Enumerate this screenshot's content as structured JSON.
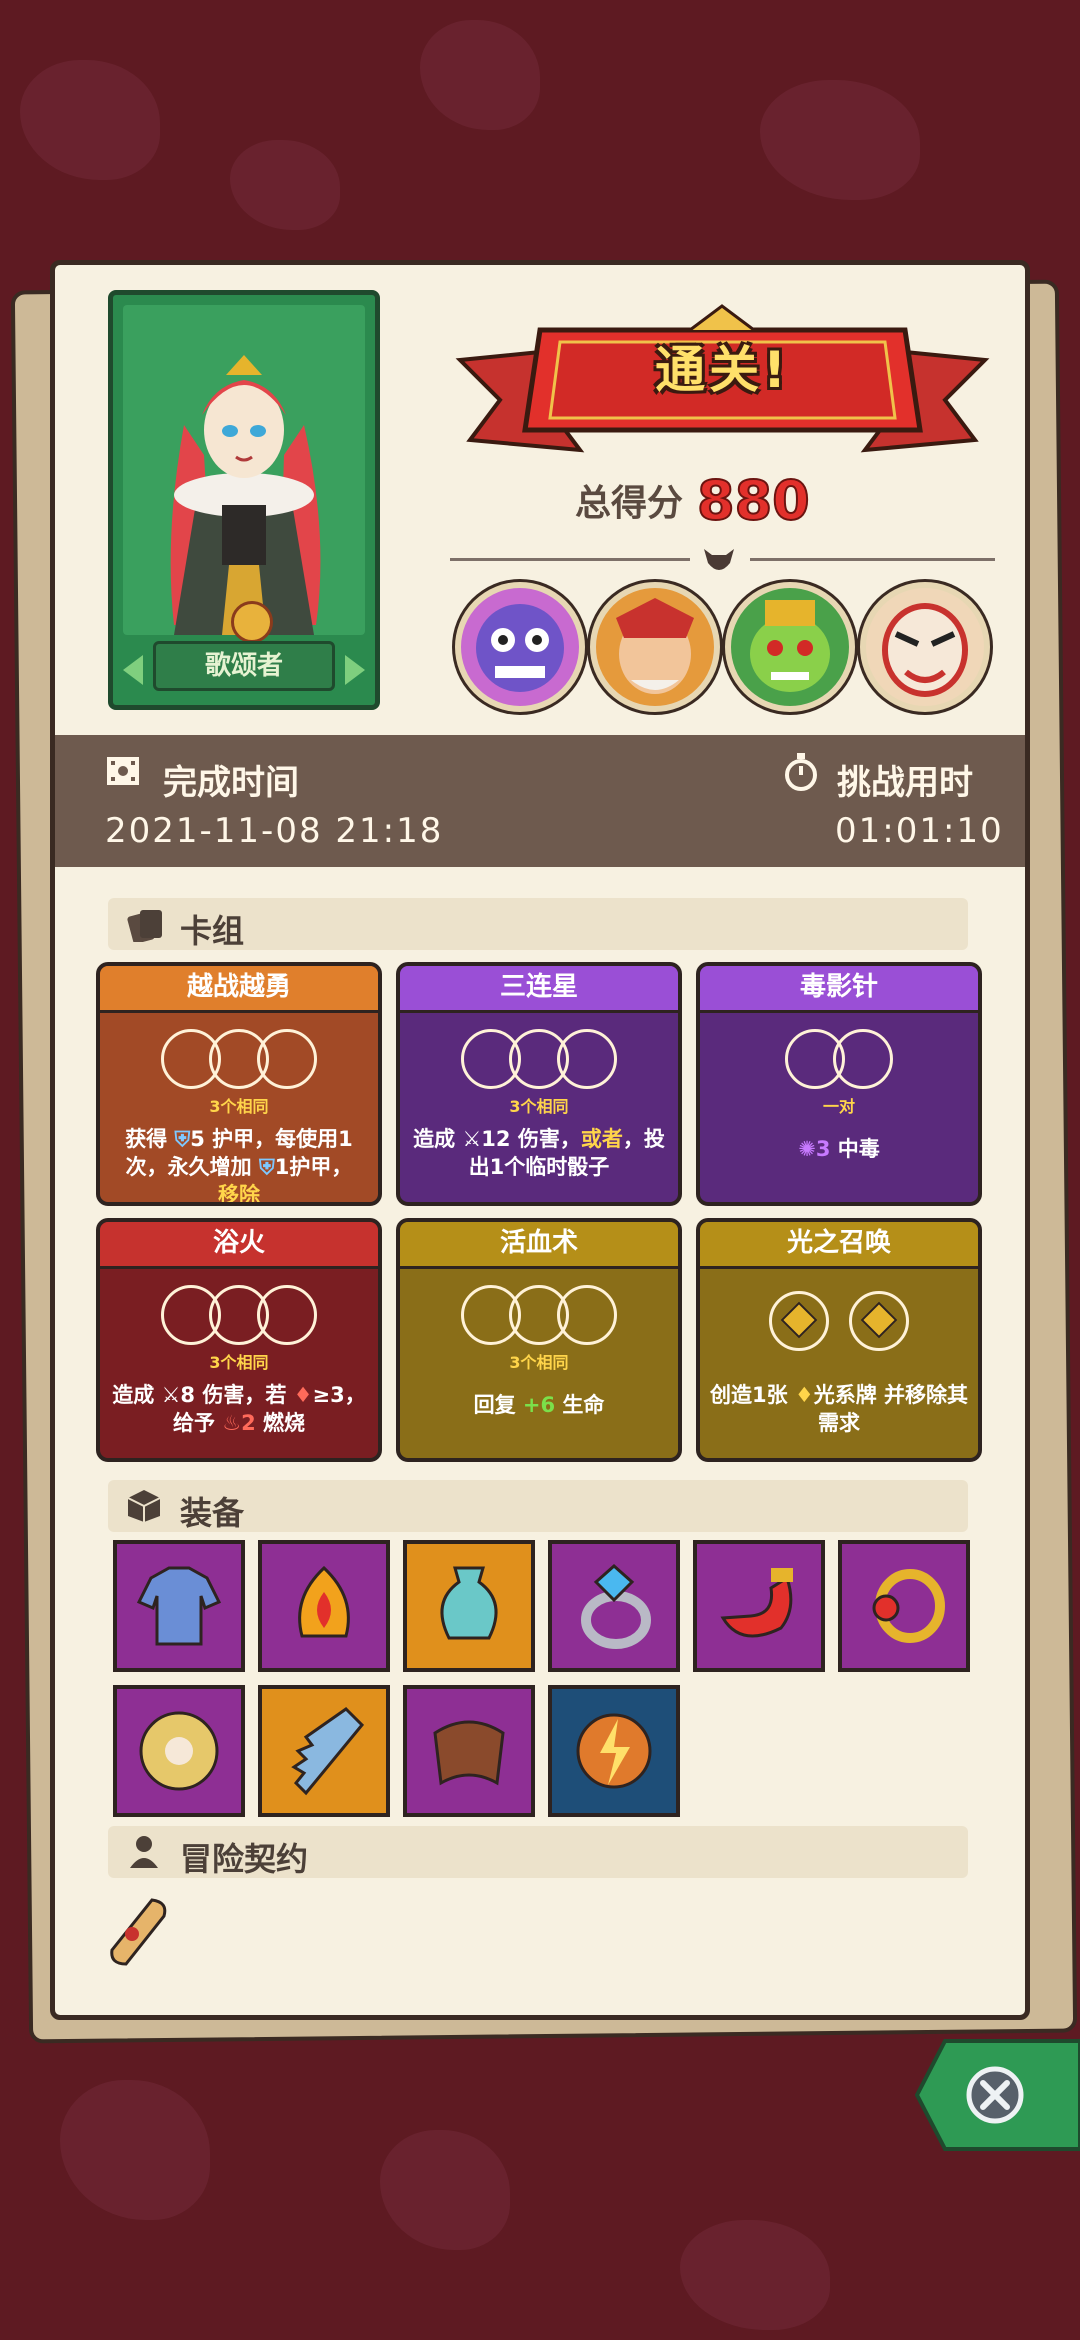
{
  "hero": {
    "name": "歌颂者"
  },
  "result": {
    "banner": "通关!",
    "score_label": "总得分",
    "score_value": "880"
  },
  "time": {
    "finish_label": "完成时间",
    "finish_value": "2021-11-08 21:18",
    "duration_label": "挑战用时",
    "duration_value": "01:01:10"
  },
  "sections": {
    "deck": "卡组",
    "equipment": "装备",
    "contract": "冒险契约"
  },
  "cards": [
    {
      "title": "越战越勇",
      "req": "3个相同",
      "desc_a": "获得",
      "desc_b": "5 护甲，每使用1次，永久增加",
      "desc_c": "1护甲，",
      "desc_hl": "移除",
      "color": "orange"
    },
    {
      "title": "三连星",
      "req": "3个相同",
      "desc_a": "造成",
      "desc_b": "12 伤害，",
      "desc_hl": "或者",
      "desc_c": "，投出1个临时骰子",
      "color": "purple"
    },
    {
      "title": "毒影针",
      "req": "一对",
      "desc_a": "3",
      "desc_b": "中毒",
      "color": "purple"
    },
    {
      "title": "浴火",
      "req": "3个相同",
      "desc_a": "造成",
      "desc_b": "8 伤害，若",
      "desc_c": "≥3，给予",
      "desc_d": "2",
      "desc_e": "燃烧",
      "color": "red"
    },
    {
      "title": "活血术",
      "req": "3个相同",
      "desc_a": "回复",
      "desc_b": "+6",
      "desc_c": "生命",
      "color": "olive"
    },
    {
      "title": "光之召唤",
      "desc_a": "创造1张",
      "desc_b": "光系牌 并移除其需求",
      "color": "olive"
    }
  ],
  "equipment_icons": [
    "tunic-icon",
    "fire-bell-icon",
    "vase-icon",
    "diamond-ring-icon",
    "red-horn-icon",
    "gold-ring-icon",
    "shield-disc-icon",
    "saw-blade-icon",
    "leather-bracer-icon",
    "lightning-orb-icon"
  ],
  "colors": {
    "accent_red": "#e2302b",
    "banner_text": "#ffe06a",
    "paper": "#f7f1e1",
    "band": "#6e5a4e"
  }
}
